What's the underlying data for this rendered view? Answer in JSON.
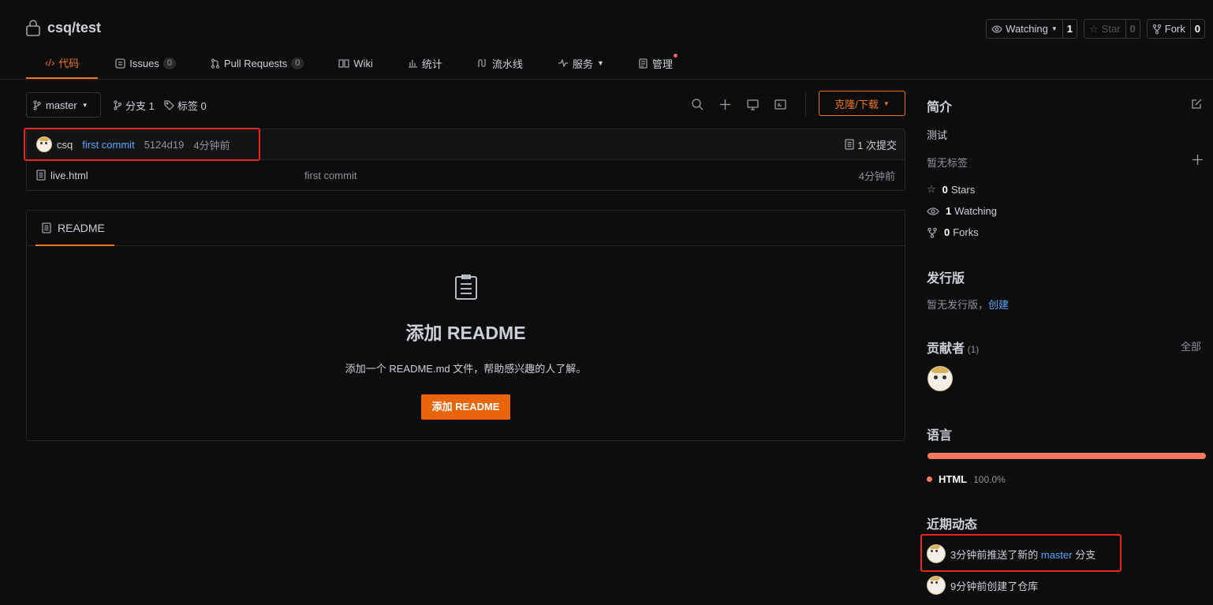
{
  "repo": {
    "name": "csq/test"
  },
  "header_buttons": {
    "watch": {
      "label": "Watching",
      "count": "1"
    },
    "star": {
      "label": "Star",
      "count": "0"
    },
    "fork": {
      "label": "Fork",
      "count": "0"
    }
  },
  "tabs": [
    {
      "label": "代码",
      "icon": "code-icon",
      "active": true
    },
    {
      "label": "Issues",
      "count": "0",
      "icon": "issues-icon"
    },
    {
      "label": "Pull Requests",
      "count": "0",
      "icon": "pull-request-icon"
    },
    {
      "label": "Wiki",
      "icon": "wiki-icon"
    },
    {
      "label": "统计",
      "icon": "stats-icon"
    },
    {
      "label": "流水线",
      "icon": "pipeline-icon"
    },
    {
      "label": "服务",
      "icon": "pulse-icon"
    },
    {
      "label": "管理",
      "icon": "manage-icon"
    }
  ],
  "toolbar": {
    "branch": "master",
    "branches_label": "分支 1",
    "tags_label": "标签 0",
    "clone_label": "克隆/下载"
  },
  "commit": {
    "author": "csq",
    "message": "first commit",
    "hash": "5124d19",
    "time": "4分钟前",
    "total": "1 次提交"
  },
  "files": [
    {
      "name": "live.html",
      "message": "first commit",
      "time": "4分钟前"
    }
  ],
  "readme": {
    "tab_label": "README",
    "title": "添加 README",
    "description": "添加一个 README.md 文件，帮助感兴趣的人了解。",
    "button": "添加 README"
  },
  "sidebar": {
    "intro_title": "简介",
    "intro_text": "测试",
    "no_tags": "暂无标签",
    "stats": {
      "stars_count": "0",
      "stars_label": "Stars",
      "watching_count": "1",
      "watching_label": "Watching",
      "forks_count": "0",
      "forks_label": "Forks"
    },
    "release_title": "发行版",
    "release_text": "暂无发行版，",
    "release_link": "创建",
    "contrib_title": "贡献者",
    "contrib_count": "(1)",
    "contrib_all": "全部",
    "lang_title": "语言",
    "lang_name": "HTML",
    "lang_pct": "100.0%",
    "lang_color": "#f37a5e",
    "activity_title": "近期动态",
    "activity": [
      {
        "prefix": "3分钟前推送了新的",
        "link": "master",
        "suffix": "分支"
      },
      {
        "prefix": "9分钟前创建了仓库",
        "link": "",
        "suffix": ""
      }
    ]
  },
  "colors": {
    "accent": "#f0761a",
    "highlight": "#e8261f",
    "link": "#58a6ff"
  }
}
